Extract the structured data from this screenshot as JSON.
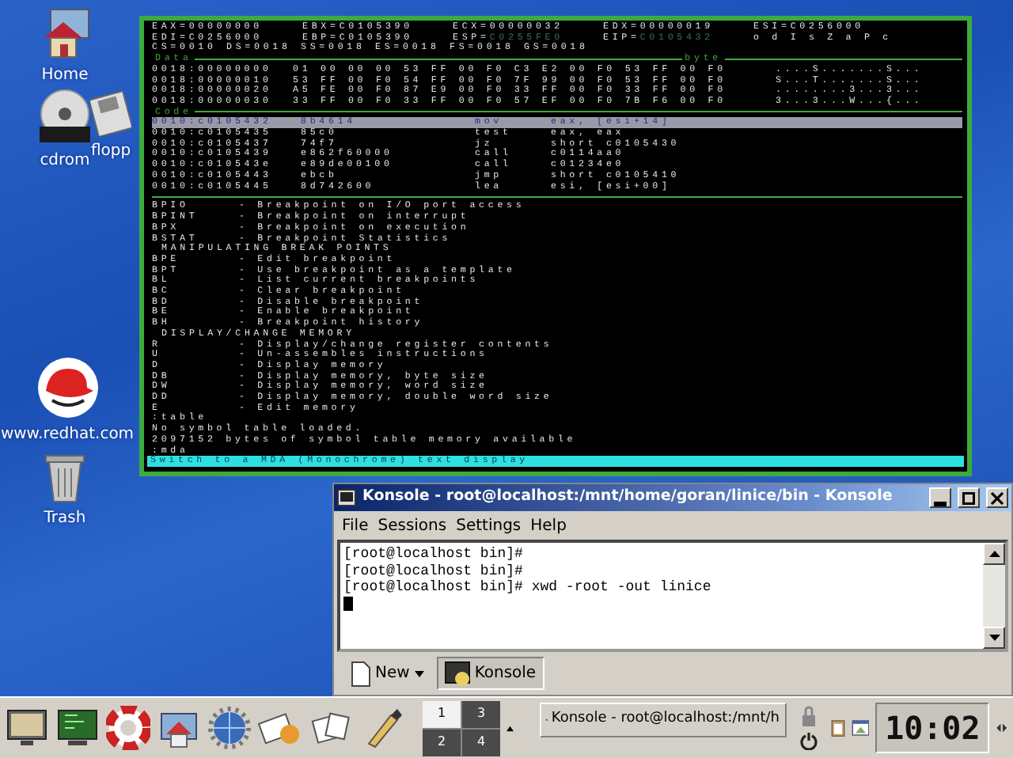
{
  "desktop_icons": [
    {
      "label": "Home",
      "kind": "home"
    },
    {
      "label": "cdrom",
      "kind": "disc"
    },
    {
      "label": "flopp",
      "kind": "floppy"
    },
    {
      "label": "www.redhat.com",
      "kind": "hat"
    },
    {
      "label": "Trash",
      "kind": "trash"
    }
  ],
  "debugger": {
    "register_rows": [
      [
        {
          "label": "EAX=",
          "value": "00000000",
          "dim": false
        },
        {
          "label": "EBX=",
          "value": "C0105390",
          "dim": false
        },
        {
          "label": "ECX=",
          "value": "00000032",
          "dim": false
        },
        {
          "label": "EDX=",
          "value": "00000019",
          "dim": false
        },
        {
          "label": "ESI=",
          "value": "C0256000",
          "dim": false
        }
      ],
      [
        {
          "label": "EDI=",
          "value": "C0256000",
          "dim": false
        },
        {
          "label": "EBP=",
          "value": "C0105390",
          "dim": false
        },
        {
          "label": "ESP=",
          "value": "C0255FE0",
          "dim": true
        },
        {
          "label": "EIP=",
          "value": "C0105432",
          "dim": true
        },
        {
          "label": "o d I s Z a P c",
          "dim": false
        }
      ],
      [
        {
          "label": "CS=",
          "value": "0010",
          "dim": false
        },
        {
          "label": "DS=",
          "value": "0018",
          "dim": false
        },
        {
          "label": "SS=",
          "value": "0018",
          "dim": false
        },
        {
          "label": "ES=",
          "value": "0018",
          "dim": false
        },
        {
          "label": "FS=",
          "value": "0018",
          "dim": false
        },
        {
          "label": "GS=",
          "value": "0018",
          "dim": false
        }
      ]
    ],
    "data_title": "Data",
    "data_mode": "byte",
    "data_rows": [
      {
        "address": "0018:00000000",
        "bytes": "01 00 00 00 53 FF 00 F0 C3 E2 00 F0 53 FF 00 F0",
        "ascii": "....S.......S..."
      },
      {
        "address": "0018:00000010",
        "bytes": "53 FF 00 F0 54 FF 00 F0 7F 99 00 F0 53 FF 00 F0",
        "ascii": "S...T.......S..."
      },
      {
        "address": "0018:00000020",
        "bytes": "A5 FE 00 F0 87 E9 00 F0 33 FF 00 F0 33 FF 00 F0",
        "ascii": "........3...3..."
      },
      {
        "address": "0018:00000030",
        "bytes": "33 FF 00 F0 33 FF 00 F0 57 EF 00 F0 7B F6 00 F0",
        "ascii": "3...3...W...{..."
      }
    ],
    "code_title": "Code",
    "code_rows": [
      {
        "address": "0010:c0105432",
        "opcode": "8b4614",
        "mnemonic": "mov",
        "operands": "eax, [esi+14]",
        "selected": true
      },
      {
        "address": "0010:c0105435",
        "opcode": "85c0",
        "mnemonic": "test",
        "operands": "eax, eax",
        "selected": false
      },
      {
        "address": "0010:c0105437",
        "opcode": "74f7",
        "mnemonic": "jz",
        "operands": "short c0105430",
        "selected": false
      },
      {
        "address": "0010:c0105439",
        "opcode": "e862f60000",
        "mnemonic": "call",
        "operands": "c0114aa0",
        "selected": false
      },
      {
        "address": "0010:c010543e",
        "opcode": "e89de00100",
        "mnemonic": "call",
        "operands": "c01234e0",
        "selected": false
      },
      {
        "address": "0010:c0105443",
        "opcode": "ebcb",
        "mnemonic": "jmp",
        "operands": "short c0105410",
        "selected": false
      },
      {
        "address": "0010:c0105445",
        "opcode": "8d742600",
        "mnemonic": "lea",
        "operands": "esi, [esi+00]",
        "selected": false
      }
    ],
    "command_lines": [
      {
        "kind": "help",
        "command": "BPIO",
        "text": "- Breakpoint on I/O port access"
      },
      {
        "kind": "help",
        "command": "BPINT",
        "text": "- Breakpoint on interrupt"
      },
      {
        "kind": "help",
        "command": "BPX",
        "text": "- Breakpoint on execution"
      },
      {
        "kind": "help",
        "command": "BSTAT",
        "text": "- Breakpoint Statistics"
      },
      {
        "kind": "heading",
        "text": "MANIPULATING BREAK POINTS"
      },
      {
        "kind": "help",
        "command": "BPE",
        "text": "- Edit breakpoint"
      },
      {
        "kind": "help",
        "command": "BPT",
        "text": "- Use breakpoint as a template"
      },
      {
        "kind": "help",
        "command": "BL",
        "text": "- List current breakpoints"
      },
      {
        "kind": "help",
        "command": "BC",
        "text": "- Clear breakpoint"
      },
      {
        "kind": "help",
        "command": "BD",
        "text": "- Disable breakpoint"
      },
      {
        "kind": "help",
        "command": "BE",
        "text": "- Enable breakpoint"
      },
      {
        "kind": "help",
        "command": "BH",
        "text": "- Breakpoint history"
      },
      {
        "kind": "heading",
        "text": "DISPLAY/CHANGE MEMORY"
      },
      {
        "kind": "help",
        "command": "R",
        "text": "- Display/change register contents"
      },
      {
        "kind": "help",
        "command": "U",
        "text": "- Un-assembles instructions"
      },
      {
        "kind": "help",
        "command": "D",
        "text": "- Display memory"
      },
      {
        "kind": "help",
        "command": "DB",
        "text": "- Display memory, byte size"
      },
      {
        "kind": "help",
        "command": "DW",
        "text": "- Display memory, word size"
      },
      {
        "kind": "help",
        "command": "DD",
        "text": "- Display memory, double word size"
      },
      {
        "kind": "help",
        "command": "E",
        "text": "- Edit memory"
      },
      {
        "kind": "output",
        "text": ":table"
      },
      {
        "kind": "output",
        "text": "No symbol table loaded."
      },
      {
        "kind": "output",
        "text": "2097152 bytes of symbol table memory available"
      },
      {
        "kind": "output",
        "text": ":mda"
      }
    ],
    "status": "Switch to a MDA (Monochrome) text display"
  },
  "konsole": {
    "title": "Konsole - root@localhost:/mnt/home/goran/linice/bin - Konsole",
    "menu": [
      "File",
      "Sessions",
      "Settings",
      "Help"
    ],
    "lines": [
      "[root@localhost bin]#",
      "[root@localhost bin]#",
      "[root@localhost bin]# xwd -root -out linice"
    ],
    "tabs": [
      {
        "label": "New",
        "kind": "new",
        "selected": false
      },
      {
        "label": "Konsole",
        "kind": "session",
        "selected": true
      }
    ]
  },
  "taskbar": {
    "pager": [
      {
        "label": "1",
        "selected": true
      },
      {
        "label": "3",
        "selected": false
      },
      {
        "label": "2",
        "selected": false
      },
      {
        "label": "4",
        "selected": false
      }
    ],
    "task": "Konsole - root@localhost:/mnt/h",
    "clock": "10:02"
  }
}
